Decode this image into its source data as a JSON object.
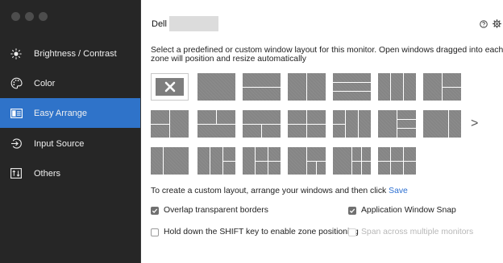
{
  "sidebar": {
    "items": [
      {
        "label": "Brightness / Contrast",
        "icon": "sun-icon"
      },
      {
        "label": "Color",
        "icon": "palette-icon"
      },
      {
        "label": "Easy Arrange",
        "icon": "window-layout-icon",
        "active": true
      },
      {
        "label": "Input Source",
        "icon": "input-source-icon"
      },
      {
        "label": "Others",
        "icon": "others-icon"
      }
    ],
    "colors": {
      "background": "#262626",
      "active": "#2f73c9"
    }
  },
  "header": {
    "brand": "Dell"
  },
  "main": {
    "description": "Select a predefined or custom window layout for this monitor.  Open windows dragged into each zone will position and resize automatically",
    "next_arrow": ">",
    "custom_prefix": "To create a custom layout, arrange your windows and then click ",
    "custom_link": "Save",
    "options": {
      "overlap": {
        "label": "Overlap transparent borders",
        "checked": true
      },
      "snap": {
        "label": "Application Window Snap",
        "checked": true
      },
      "shift": {
        "label": "Hold down the SHIFT key to enable zone positioning",
        "checked": false
      },
      "span": {
        "label": "Span across multiple monitors",
        "checked": false,
        "disabled": true
      }
    },
    "colors": {
      "link": "#2c6fd1",
      "tile": "#858585"
    }
  }
}
